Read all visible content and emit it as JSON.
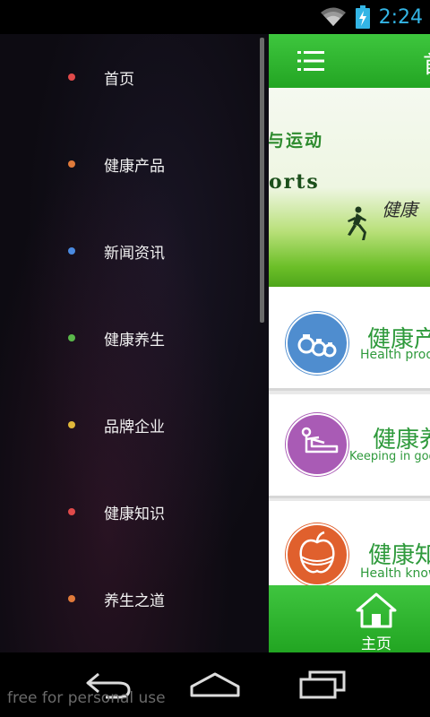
{
  "status": {
    "time": "2:24",
    "time_color": "#33b5e5"
  },
  "drawer": {
    "items": [
      {
        "label": "首页",
        "dot_color": "#e04a4a"
      },
      {
        "label": "健康产品",
        "dot_color": "#e07a3a"
      },
      {
        "label": "新闻资讯",
        "dot_color": "#4a8ae0"
      },
      {
        "label": "健康养生",
        "dot_color": "#5ab84a"
      },
      {
        "label": "品牌企业",
        "dot_color": "#e0b83a"
      },
      {
        "label": "健康知识",
        "dot_color": "#e04a4a"
      },
      {
        "label": "养生之道",
        "dot_color": "#e07a3a"
      }
    ]
  },
  "main": {
    "title": "首页",
    "banner": {
      "text_cn": "与运动",
      "text_en": "orts",
      "calligraphy": "健康"
    },
    "cards": [
      {
        "title": "健康产品",
        "subtitle": "Health products",
        "circle_color": "#4f8dcf"
      },
      {
        "title": "健康养生",
        "subtitle": "Keeping in good health",
        "circle_color": "#a95bb5"
      },
      {
        "title": "健康知识",
        "subtitle": "Health knowledge",
        "circle_color": "#e0602d"
      }
    ],
    "bottom_nav": {
      "label": "主页"
    }
  },
  "watermark": "free for personal use",
  "colors": {
    "accent_green": "#2fb52f",
    "card_text_green": "#2f9a3c"
  }
}
